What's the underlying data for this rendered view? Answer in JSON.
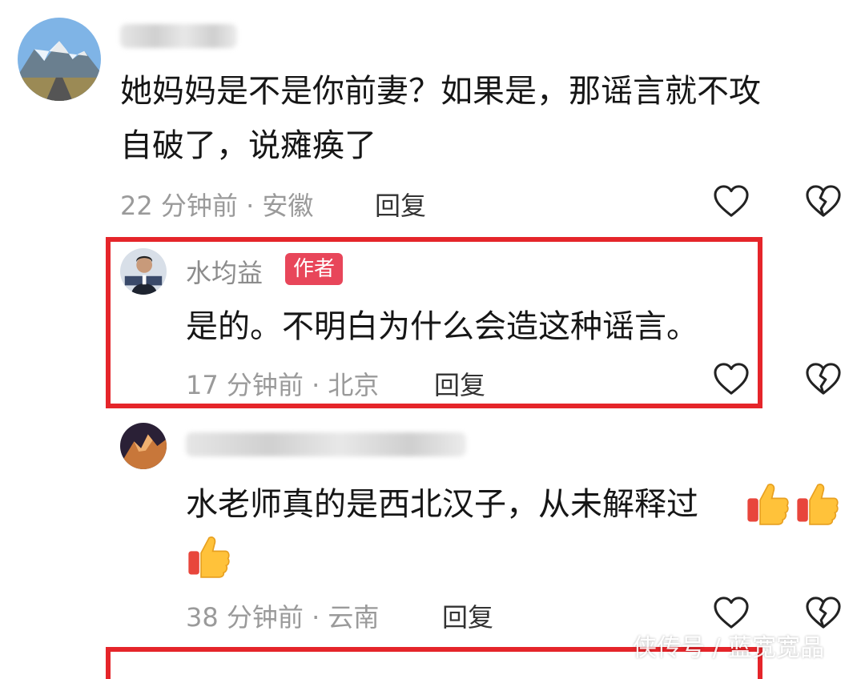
{
  "comments": [
    {
      "text_line1": "她妈妈是不是你前妻？如果是，那谣言就不攻",
      "text_line2": "自破了，说瘫痪了",
      "meta": "22 分钟前 · 安徽",
      "reply": "回复"
    },
    {
      "author": "水均益",
      "badge": "作者",
      "text": "是的。不明白为什么会造这种谣言。",
      "meta": "17 分钟前 · 北京",
      "reply": "回复"
    },
    {
      "text": "水老师真的是西北汉子，从未解释过",
      "meta": "38 分钟前 · 云南",
      "reply": "回复"
    }
  ],
  "watermark": "侠传号 / 蓝宽宽品",
  "colors": {
    "highlight": "#e5252a",
    "badge": "#e8465a"
  }
}
